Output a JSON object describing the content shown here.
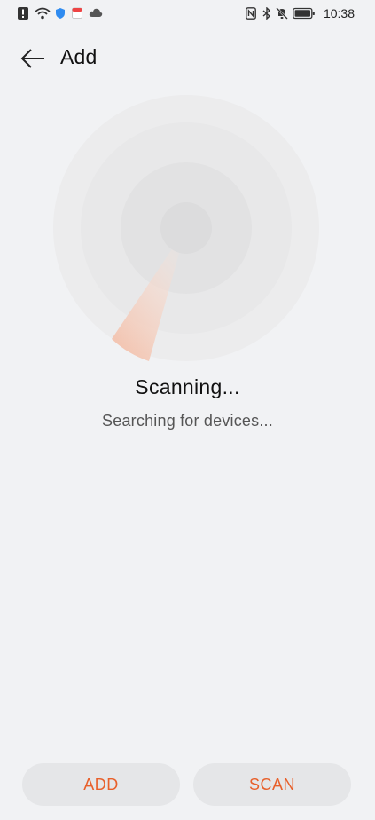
{
  "status_bar": {
    "time": "10:38",
    "left_icons": [
      "alert-icon",
      "wifi-icon",
      "shield-icon",
      "calendar-icon",
      "cloud-icon"
    ],
    "right_icons": [
      "nfc-icon",
      "bluetooth-icon",
      "mute-bell-icon",
      "battery-icon"
    ]
  },
  "header": {
    "title": "Add",
    "back_icon": "arrow-left-icon"
  },
  "scan": {
    "title": "Scanning...",
    "subtitle": "Searching for devices..."
  },
  "buttons": {
    "add_label": "ADD",
    "scan_label": "SCAN"
  },
  "colors": {
    "background": "#f1f2f4",
    "accent": "#e8602b",
    "button_bg": "#e5e6e8"
  }
}
